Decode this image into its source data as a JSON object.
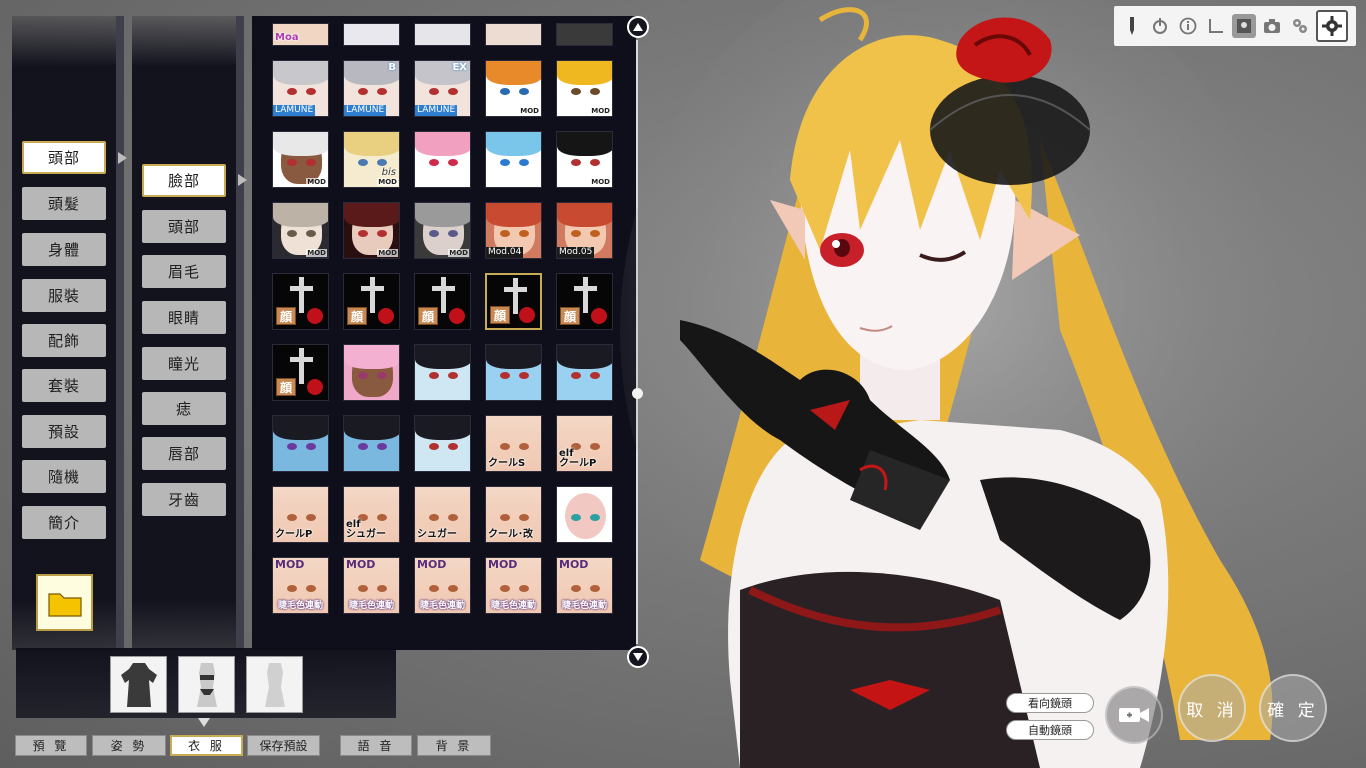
{
  "categories": {
    "items": [
      "頭部",
      "頭髮",
      "身體",
      "服裝",
      "配飾",
      "套裝",
      "預設",
      "隨機",
      "簡介"
    ],
    "active": "頭部"
  },
  "subcategories": {
    "items": [
      "臉部",
      "頭部",
      "眉毛",
      "眼睛",
      "瞳光",
      "痣",
      "唇部",
      "牙齒"
    ],
    "active": "臉部"
  },
  "thumbnails": {
    "row0": [
      {
        "label": "Moa"
      },
      {
        "label": ""
      },
      {
        "label": ""
      },
      {
        "label": ""
      },
      {
        "label": ""
      }
    ],
    "labels": {
      "r1c1": "LAMUNE",
      "r1c2": "LAMUNE",
      "r1c2b": "B",
      "r1c3": "LAMUNE",
      "r1c3b": "EX",
      "mod": "MOD",
      "bis": "bis",
      "mod04": "Mod.04",
      "mod05": "Mod.05",
      "kao": "顔",
      "kuru_s": "クールS",
      "elf_kuru_p": "elf\nクールP",
      "kuru_p": "クールP",
      "elf_sugar": "elf\nシュガー",
      "sugar": "シュガー",
      "kuru_kai": "クール･改",
      "eyelash_sync": "睫毛色連動"
    }
  },
  "clothing_states": [
    "full",
    "underwear",
    "nude"
  ],
  "bottom_tabs": [
    "預 覽",
    "姿 勢",
    "衣 服",
    "保存預設",
    "語 音",
    "背 景"
  ],
  "active_tab": "衣 服",
  "camera": {
    "look_at_camera": "看向鏡頭",
    "auto_camera": "自動鏡頭"
  },
  "actions": {
    "cancel": "取 消",
    "confirm": "確 定"
  },
  "toolbar_icons": [
    "pen-icon",
    "power-icon",
    "info-icon",
    "angle-icon",
    "scene-icon",
    "camera-icon",
    "gears-icon",
    "settings-icon"
  ],
  "colors": {
    "accent_gold": "#c8ac55",
    "panel_dark": "#0f0f1b",
    "button_gray": "#b7b7b7"
  }
}
